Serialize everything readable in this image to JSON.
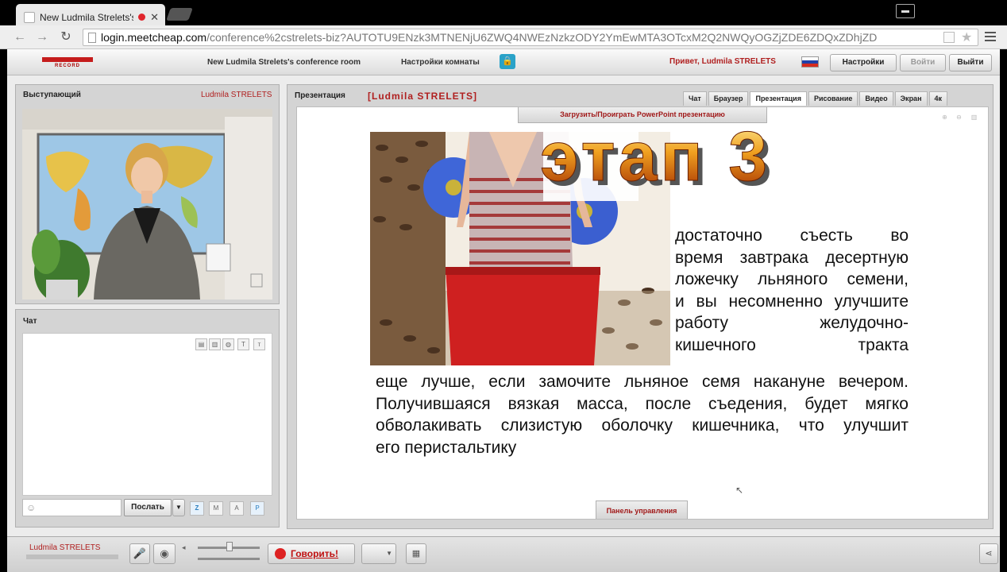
{
  "browser": {
    "tab_title": "New Ludmila Strelets's",
    "url_host": "login.meetcheap.com",
    "url_path": "/conference%2cstrelets-biz?AUTOTU9ENzk3MTNENjU6ZWQ4NWEzNzkzODY2YmEwMTA3OTcxM2Q2NWQyOGZjZDE6ZDQxZDhjZD"
  },
  "header": {
    "logo_text": "RECORD",
    "room_title": "New Ludmila Strelets's conference room",
    "room_settings": "Настройки комнаты",
    "greeting": "Привет, Ludmila STRELETS",
    "settings_btn": "Настройки",
    "login_btn": "Войти",
    "logout_btn": "Выйти"
  },
  "speaker": {
    "title": "Выступающий",
    "name": "Ludmila STRELETS"
  },
  "chat": {
    "title": "Чат",
    "send_label": "Послать"
  },
  "presentation": {
    "title": "Презентация",
    "presenter": "[Ludmila STRELETS]",
    "upload_label": "Загрузить/Проиграть PowerPoint презентацию",
    "tabs": [
      "Чат",
      "Браузер",
      "Презентация",
      "Рисование",
      "Видео",
      "Экран",
      "4к"
    ],
    "active_tab": "Презентация",
    "control_panel": "Панель управления"
  },
  "slide": {
    "heading": "этап 3",
    "para1_lines": [
      "достаточно съесть во",
      "время завтрака десертную",
      "ложечку льняного семени,",
      "и вы несомненно улучшите",
      "работу желудочно-",
      "кишечного тракта"
    ],
    "para2_lines": [
      "еще лучше, если  замочите льняное семя накануне вечером.",
      "Получившаяся вязкая масса, после съедения, будет мягко",
      "обволакивать слизистую оболочку кишечника, что улучшит",
      "его перистальтику"
    ]
  },
  "bottom": {
    "user_name": "Ludmila STRELETS",
    "speak_label": "Говорить!"
  },
  "colors": {
    "accent_red": "#b02020",
    "heading_orange": "#d05a08"
  }
}
